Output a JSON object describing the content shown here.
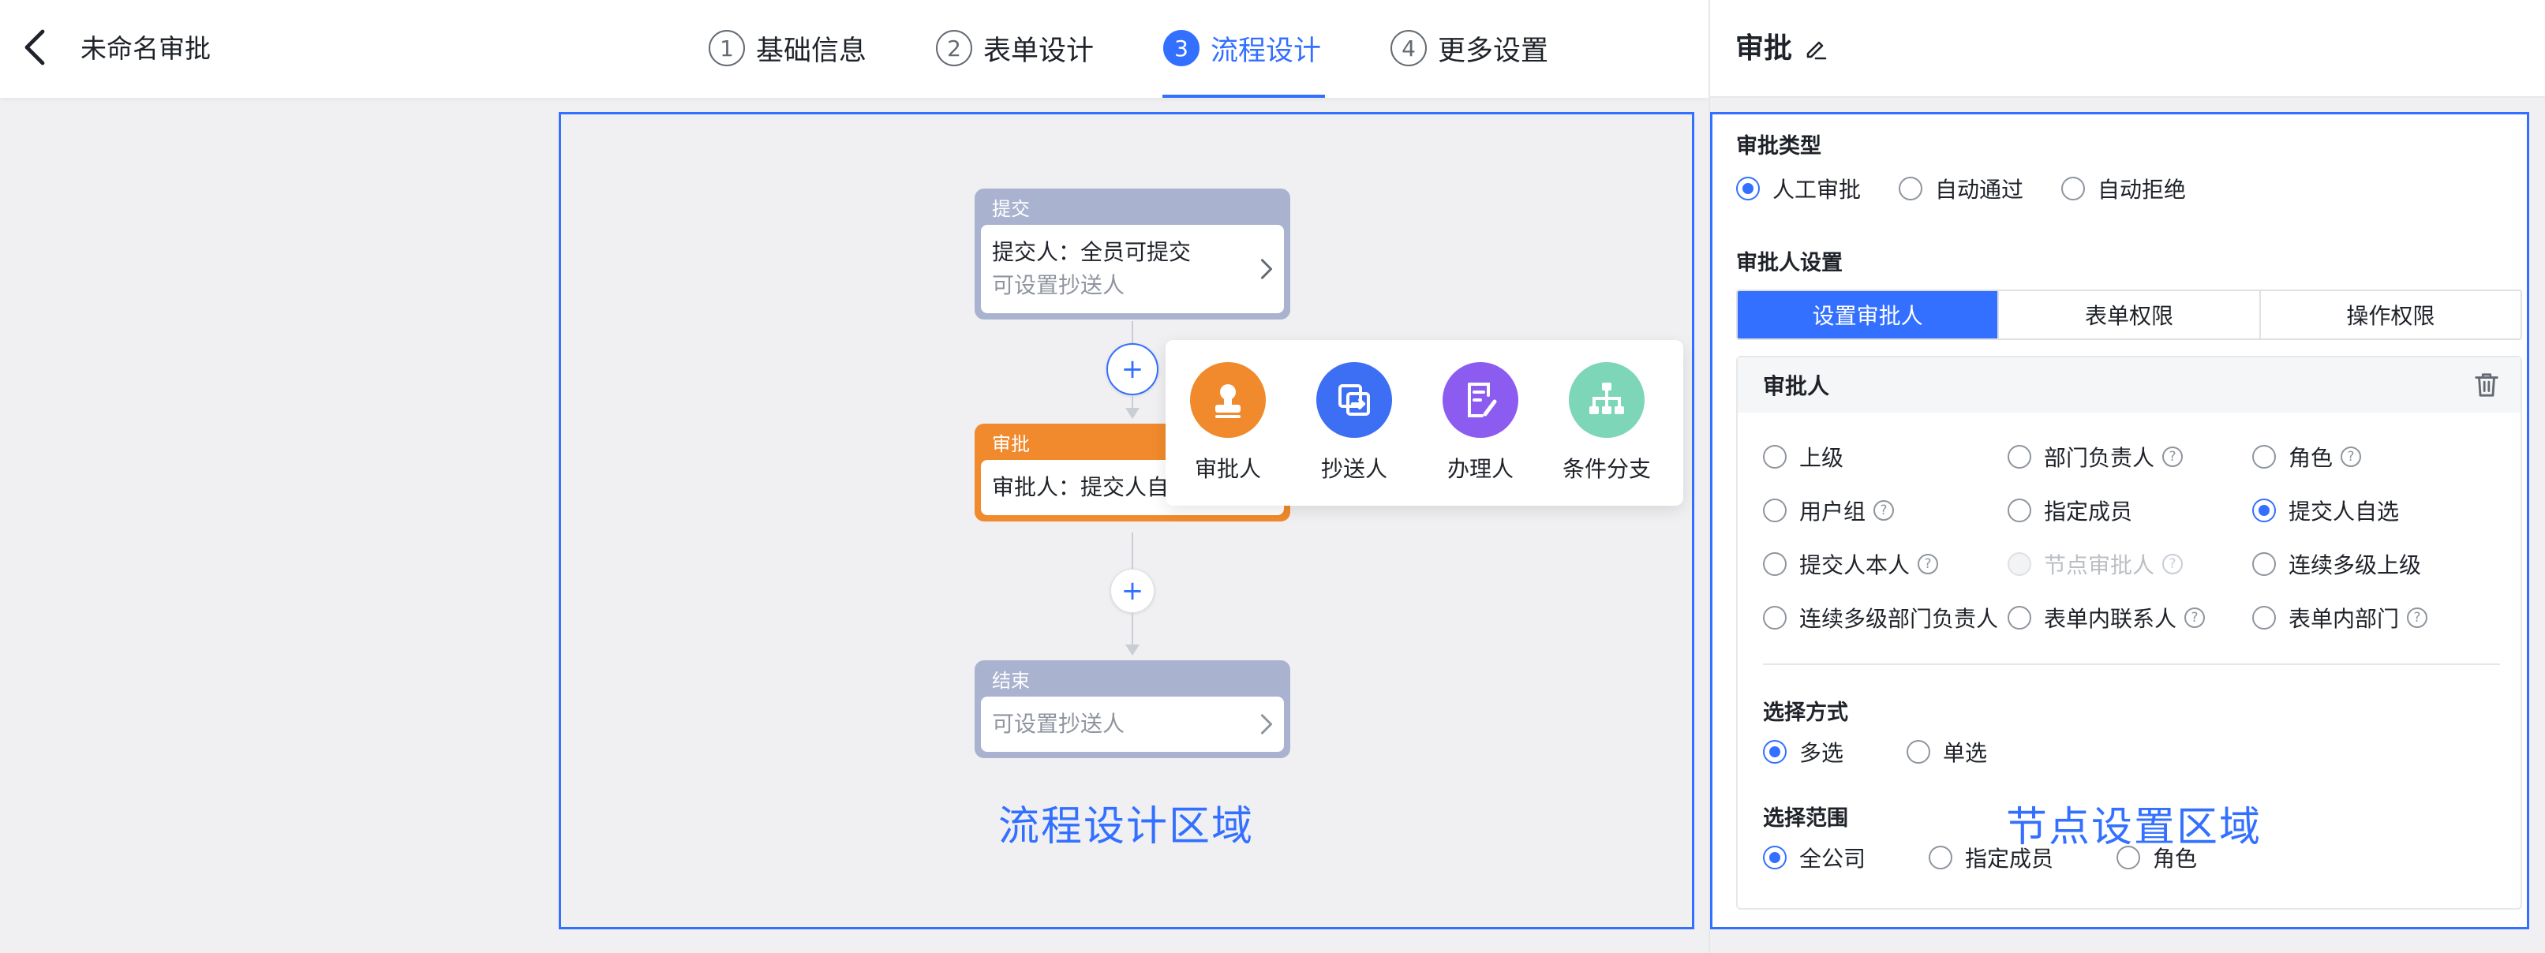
{
  "header": {
    "title": "未命名审批",
    "steps": [
      {
        "num": "1",
        "label": "基础信息"
      },
      {
        "num": "2",
        "label": "表单设计"
      },
      {
        "num": "3",
        "label": "流程设计"
      },
      {
        "num": "4",
        "label": "更多设置"
      }
    ],
    "active_step": "3"
  },
  "flow": {
    "nodes": {
      "submit": {
        "title": "提交",
        "line1": "提交人：全员可提交",
        "line2": "可设置抄送人"
      },
      "approve": {
        "title": "审批",
        "line1": "审批人：提交人自选"
      },
      "end": {
        "title": "结束",
        "line2": "可设置抄送人"
      }
    },
    "add_symbol": "+",
    "popup_items": [
      {
        "label": "审批人",
        "icon": "stamp-icon",
        "color": "#f08a2c"
      },
      {
        "label": "抄送人",
        "icon": "copy-icon",
        "color": "#3d6ff5"
      },
      {
        "label": "办理人",
        "icon": "edit-doc-icon",
        "color": "#8c5cf0"
      },
      {
        "label": "条件分支",
        "icon": "branch-icon",
        "color": "#7ed6b8"
      }
    ],
    "area_label": "流程设计区域"
  },
  "panel": {
    "title": "审批",
    "approval_type": {
      "label": "审批类型",
      "options": [
        "人工审批",
        "自动通过",
        "自动拒绝"
      ],
      "selected": "人工审批"
    },
    "approver_settings": {
      "label": "审批人设置",
      "tabs": [
        "设置审批人",
        "表单权限",
        "操作权限"
      ],
      "active_tab": "设置审批人"
    },
    "approver_card": {
      "title": "审批人",
      "options": [
        {
          "label": "上级",
          "help": false
        },
        {
          "label": "部门负责人",
          "help": true
        },
        {
          "label": "角色",
          "help": true
        },
        {
          "label": "用户组",
          "help": true
        },
        {
          "label": "指定成员",
          "help": false
        },
        {
          "label": "提交人自选",
          "help": false
        },
        {
          "label": "提交人本人",
          "help": true
        },
        {
          "label": "节点审批人",
          "help": true
        },
        {
          "label": "连续多级上级",
          "help": false
        },
        {
          "label": "连续多级部门负责人",
          "help": false
        },
        {
          "label": "表单内联系人",
          "help": true
        },
        {
          "label": "表单内部门",
          "help": true
        }
      ],
      "selected": "提交人自选",
      "disabled": "节点审批人",
      "help_symbol": "?",
      "select_mode": {
        "label": "选择方式",
        "options": [
          "多选",
          "单选"
        ],
        "selected": "多选"
      },
      "select_range": {
        "label": "选择范围",
        "options": [
          "全公司",
          "指定成员",
          "角色"
        ],
        "selected": "全公司"
      }
    },
    "area_label": "节点设置区域"
  },
  "colors": {
    "accent": "#3370ff",
    "approve_node": "#f08a2c",
    "neutral_node": "#a9b3cf"
  }
}
